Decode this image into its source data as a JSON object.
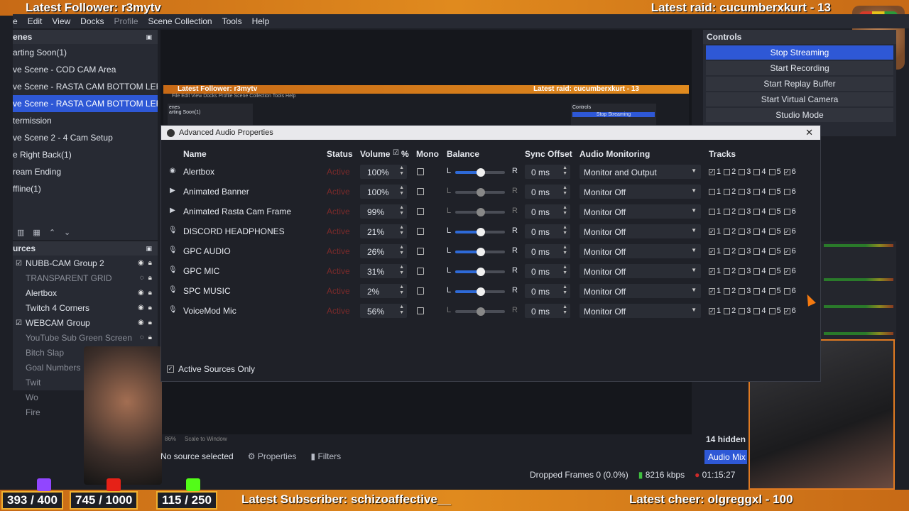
{
  "overlay": {
    "latest_follower": "Latest Follower: r3mytv",
    "latest_raid": "Latest raid: cucumberxkurt - 13",
    "latest_subscriber": "Latest Subscriber: schizoaffective__",
    "latest_cheer": "Latest cheer: olgreggxl - 100",
    "goals": [
      "393 / 400",
      "745 / 1000",
      "115 / 250"
    ]
  },
  "menubar": [
    "e",
    "Edit",
    "View",
    "Docks",
    "Profile",
    "Scene Collection",
    "Tools",
    "Help"
  ],
  "scenes": {
    "title": "enes",
    "items": [
      "arting Soon(1)",
      "ve Scene - COD CAM Area",
      "ve Scene - RASTA CAM BOTTOM LEFT",
      "ve Scene - RASTA CAM BOTTOM LEFT -",
      "termission",
      "ve Scene 2 - 4 Cam Setup",
      "e Right Back(1)",
      "ream Ending",
      "ffline(1)"
    ],
    "selected_index": 3
  },
  "sources": {
    "title": "urces",
    "items": [
      {
        "label": "NUBB-CAM  Group 2",
        "dim": false,
        "check": true
      },
      {
        "label": "TRANSPARENT GRID",
        "dim": true,
        "check": false
      },
      {
        "label": "Alertbox",
        "dim": false,
        "check": false
      },
      {
        "label": "Twitch 4 Corners",
        "dim": false,
        "check": false
      },
      {
        "label": "WEBCAM Group",
        "dim": false,
        "check": true
      },
      {
        "label": "YouTube Sub Green Screen",
        "dim": true,
        "check": false
      },
      {
        "label": "Bitch Slap",
        "dim": true,
        "check": false
      },
      {
        "label": "Goal Numbers",
        "dim": true,
        "check": false
      },
      {
        "label": "Twit",
        "dim": true,
        "check": false
      },
      {
        "label": "Wo",
        "dim": true,
        "check": false
      },
      {
        "label": "Fire",
        "dim": true,
        "check": false
      }
    ]
  },
  "controls": {
    "title": "Controls",
    "buttons": [
      "Stop Streaming",
      "Start Recording",
      "Start Replay Buffer",
      "Start Virtual Camera",
      "Studio Mode"
    ]
  },
  "nested": {
    "follower": "Latest Follower: r3mytv",
    "raid": "Latest raid: cucumberxkurt - 13",
    "menu": "File  Edit  View  Docks  Profile  Scene Collection  Tools  Help",
    "scenes_label": "enes",
    "scene_item": "arting Soon(1)",
    "controls_label": "Controls",
    "stop_label": "Stop Streaming"
  },
  "dialog": {
    "title": "Advanced Audio Properties",
    "headers": {
      "name": "Name",
      "status": "Status",
      "volume": "Volume",
      "pct": "%",
      "mono": "Mono",
      "balance": "Balance",
      "sync": "Sync Offset",
      "monitoring": "Audio Monitoring",
      "tracks": "Tracks"
    },
    "rows": [
      {
        "icon": "◉",
        "name": "Alertbox",
        "status": "Active",
        "volume": "100%",
        "sync": "0 ms",
        "monitoring": "Monitor and Output",
        "balance_active": true,
        "tracks": [
          1,
          0,
          0,
          0,
          0,
          1
        ]
      },
      {
        "icon": "▶",
        "name": "Animated Banner",
        "status": "Active",
        "volume": "100%",
        "sync": "0 ms",
        "monitoring": "Monitor Off",
        "balance_active": false,
        "tracks": [
          0,
          0,
          0,
          0,
          0,
          0
        ]
      },
      {
        "icon": "▶",
        "name": "Animated Rasta Cam Frame",
        "status": "Active",
        "volume": "99%",
        "sync": "0 ms",
        "monitoring": "Monitor Off",
        "balance_active": false,
        "tracks": [
          0,
          0,
          0,
          0,
          0,
          0
        ]
      },
      {
        "icon": "🎙",
        "name": "DISCORD HEADPHONES",
        "status": "Active",
        "volume": "21%",
        "sync": "0 ms",
        "monitoring": "Monitor Off",
        "balance_active": true,
        "tracks": [
          1,
          0,
          0,
          0,
          0,
          1
        ]
      },
      {
        "icon": "🎙",
        "name": "GPC AUDIO",
        "status": "Active",
        "volume": "26%",
        "sync": "0 ms",
        "monitoring": "Monitor Off",
        "balance_active": true,
        "tracks": [
          1,
          0,
          0,
          0,
          0,
          1
        ]
      },
      {
        "icon": "🎙",
        "name": "GPC MIC",
        "status": "Active",
        "volume": "31%",
        "sync": "0 ms",
        "monitoring": "Monitor Off",
        "balance_active": true,
        "tracks": [
          1,
          0,
          0,
          0,
          0,
          1
        ]
      },
      {
        "icon": "🎙",
        "name": "SPC MUSIC",
        "status": "Active",
        "volume": "2%",
        "sync": "0 ms",
        "monitoring": "Monitor Off",
        "balance_active": true,
        "tracks": [
          1,
          0,
          0,
          0,
          0,
          0
        ]
      },
      {
        "icon": "🎙",
        "name": "VoiceMod Mic",
        "status": "Active",
        "volume": "56%",
        "sync": "0 ms",
        "monitoring": "Monitor Off",
        "balance_active": false,
        "tracks": [
          1,
          0,
          0,
          0,
          0,
          1
        ]
      }
    ],
    "active_only": "Active Sources Only"
  },
  "bottom": {
    "no_source": "No source selected",
    "properties": "Properties",
    "filters": "Filters",
    "hidden": "14 hidden",
    "audio_mixer_tab": "Audio Mix",
    "dropped": "Dropped Frames 0 (0.0%)",
    "bitrate": "8216 kbps",
    "time": "01:15:27",
    "zoom": "86%",
    "scale": "Scale to Window"
  }
}
